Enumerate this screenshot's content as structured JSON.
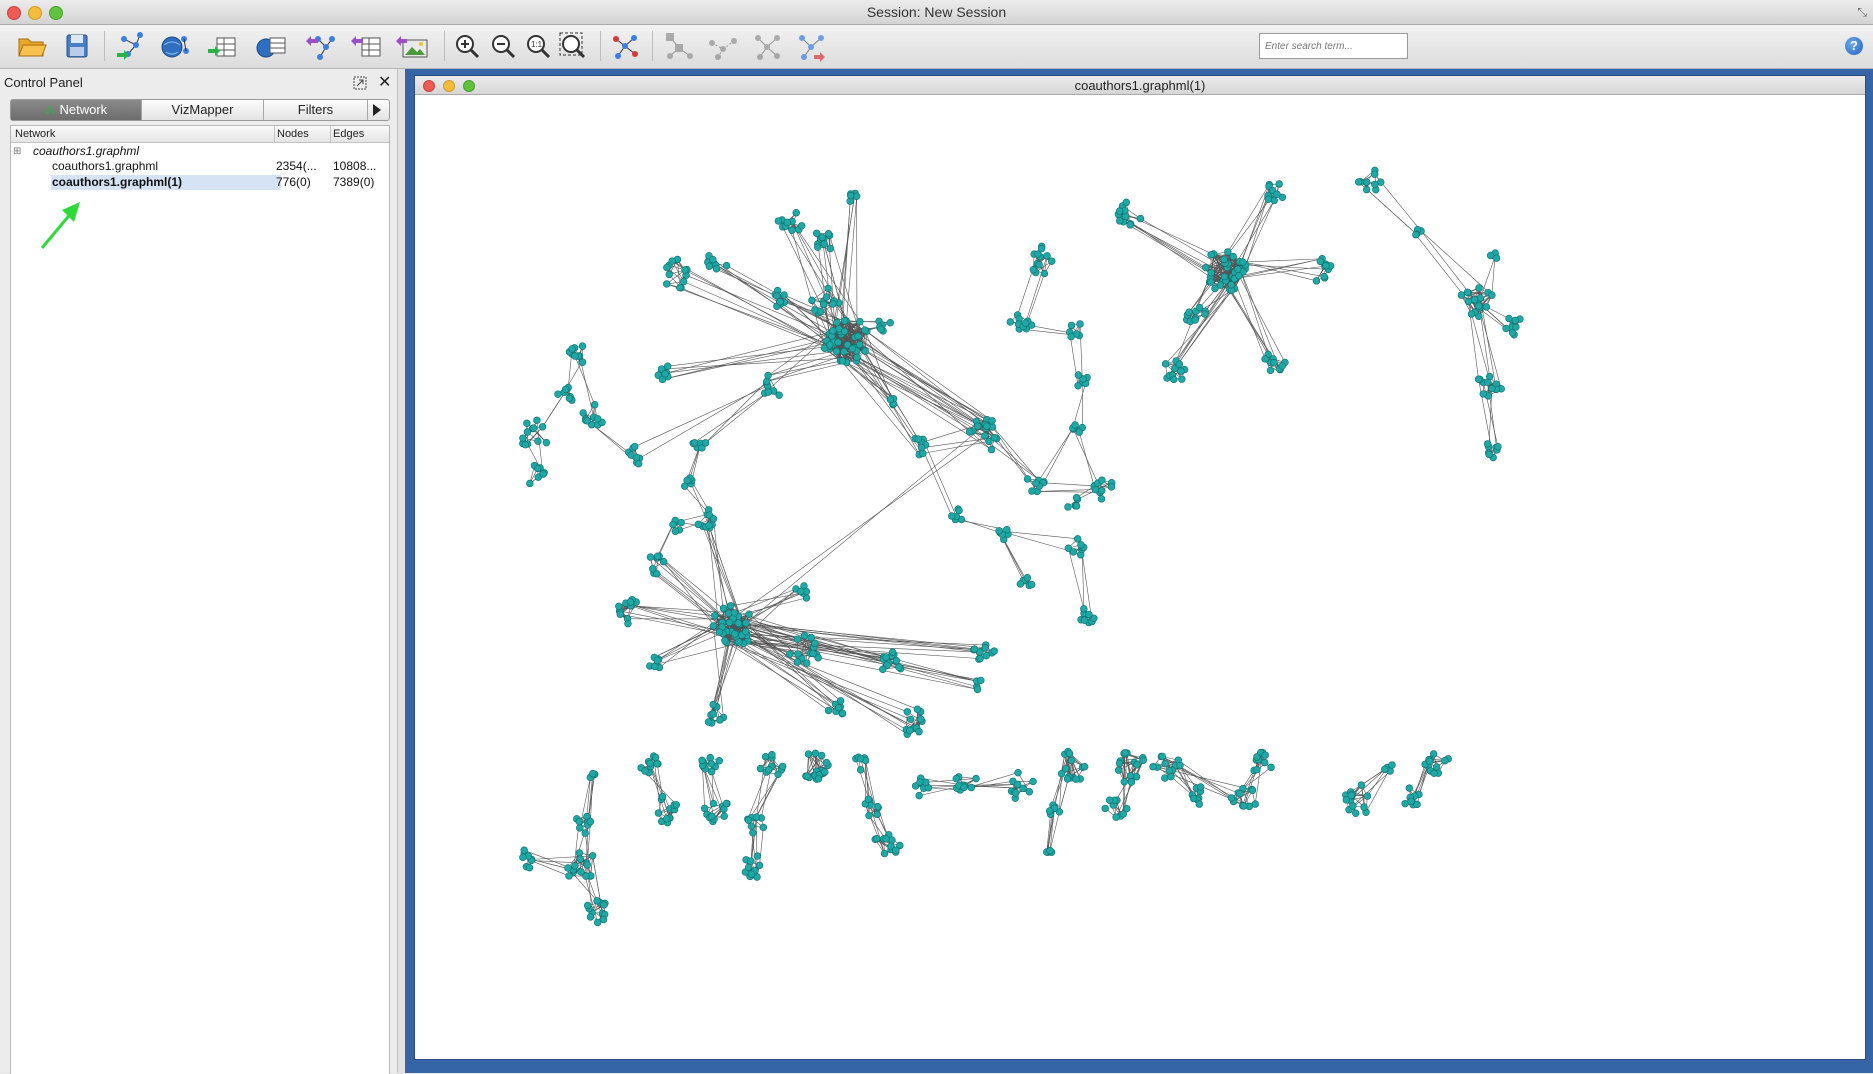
{
  "window": {
    "title": "Session: New Session"
  },
  "search": {
    "placeholder": "Enter search term..."
  },
  "help": {
    "label": "?"
  },
  "control_panel": {
    "title": "Control Panel",
    "tabs": [
      {
        "label": "Network",
        "active": true
      },
      {
        "label": "VizMapper",
        "active": false
      },
      {
        "label": "Filters",
        "active": false
      }
    ],
    "columns": {
      "network": "Network",
      "nodes": "Nodes",
      "edges": "Edges"
    },
    "rows": [
      {
        "name": "coauthors1.graphml",
        "nodes": "",
        "edges": "",
        "root": true
      },
      {
        "name": "coauthors1.graphml",
        "nodes": "2354(...",
        "edges": "10808...",
        "selected": false
      },
      {
        "name": "coauthors1.graphml(1)",
        "nodes": "776(0)",
        "edges": "7389(0)",
        "selected": true
      }
    ]
  },
  "network_window": {
    "title": "coauthors1.graphml(1)"
  },
  "colors": {
    "node": "#1fa8a6",
    "node_stroke": "#0d6e6c",
    "edge": "#555555",
    "desktop": "#3565a6",
    "arrow": "#2fd93a"
  }
}
